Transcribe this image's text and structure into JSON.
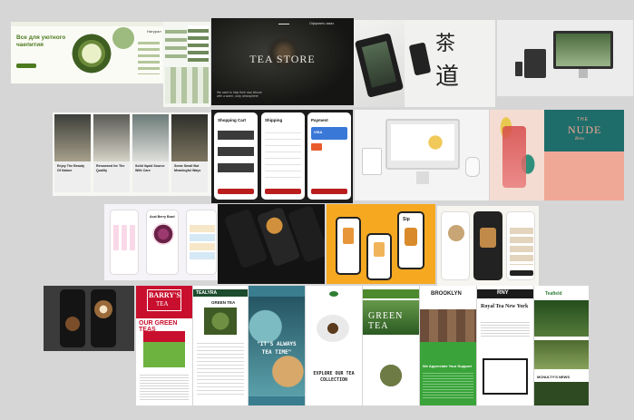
{
  "row1": {
    "herbal": {
      "headline": "Все для уютного чаепития",
      "sub_label": "Натурал"
    },
    "tea_store": {
      "brand": "TEA STORE",
      "menu_label": "Оформить заказ",
      "small_text": "We want to help their own leisure with a warm, cozy atmosphere"
    },
    "calligraphy": {
      "glyph_top": "茶",
      "glyph_bottom": "道"
    }
  },
  "row2": {
    "cards": [
      {
        "caption": "Enjoy The Beauty Of Nature"
      },
      {
        "caption": "Renowned for The Quality"
      },
      {
        "caption": "Solid liquid Source With Care"
      },
      {
        "caption": "Some Small But Meaningful Ways"
      }
    ],
    "checkout": {
      "cart_title": "Shopping Cart",
      "shipping_title": "Shipping",
      "payment_title": "Payment",
      "card_brand": "VISA"
    },
    "nude_brew": {
      "line1": "THE",
      "line2": "NUDE",
      "line3": "Brew"
    }
  },
  "row3": {
    "berry_app": {
      "title": "Acai Berry Bowl"
    },
    "sip_phone": {
      "title": "Sip"
    }
  },
  "row4": {
    "barrys": {
      "brand": "BARRY'S",
      "brand_sub": "TEA",
      "heading": "OUR GREEN TEAS"
    },
    "tea_village": {
      "brand": "TEALYRA",
      "heading": "GREEN TEA"
    },
    "always_tea": {
      "text": "\"IT'S ALWAYS TEA TIME\""
    },
    "explore": {
      "text": "EXPLORE OUR TEA COLLECTION"
    },
    "green_tea_banner": {
      "heading": "GREEN TEA"
    },
    "brooklyn": {
      "brand": "BROOKLYN",
      "support": "We Appreciate Your Support"
    },
    "royal": {
      "brand": "RNY",
      "heading": "Royal Tea New York"
    },
    "final": {
      "brand": "Teafield",
      "label": "MCNULTY'S NEWS"
    }
  },
  "colors": {
    "accent_green": "#2f7d34",
    "barrys_red": "#c8102e",
    "nude_teal": "#1f6d6a",
    "nude_peach": "#f0a896",
    "orange": "#f6a821"
  }
}
